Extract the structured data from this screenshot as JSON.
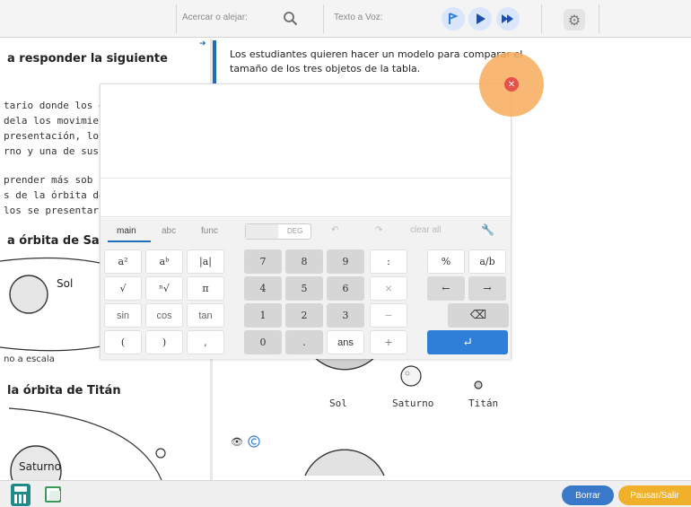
{
  "toolbar": {
    "zoom_label": "Acercar o alejar:",
    "tts_label": "Texto a Voz:"
  },
  "left": {
    "heading": "a responder la siguiente",
    "paragraph1": [
      "tario donde los e",
      "dela los movimie",
      "presentación, los",
      "rno y una de sus"
    ],
    "paragraph2": [
      "prender más sob",
      "s de la órbita de",
      "los se presentar"
    ],
    "orbit_sa_heading": "a órbita de Sa",
    "sol_label": "Sol",
    "scale_note": "no a escala",
    "orbit_titan_heading": "la órbita de Titán",
    "saturno_label": "Saturno"
  },
  "question": {
    "text": "Los estudiantes quieren hacer un modelo para comparar el tamaño de los tres objetos de la tabla."
  },
  "objects": {
    "sol": "Sol",
    "saturno": "Saturno",
    "titan": "Titán"
  },
  "calculator": {
    "tabs": [
      "main",
      "abc",
      "func"
    ],
    "active_tab": "main",
    "rad_deg": "DEG",
    "clear_all": "clear all",
    "keys": {
      "sq": "a²",
      "pow": "aᵇ",
      "abs": "|a|",
      "sqrt": "√",
      "nroot": "ⁿ√",
      "pi": "π",
      "sin": "sin",
      "cos": "cos",
      "tan": "tan",
      "lparen": "(",
      "rparen": ")",
      "comma": ",",
      "n7": "7",
      "n8": "8",
      "n9": "9",
      "n4": "4",
      "n5": "5",
      "n6": "6",
      "n1": "1",
      "n2": "2",
      "n3": "3",
      "n0": "0",
      "dot": ".",
      "ans": "ans",
      "colon": ":",
      "times": "×",
      "minus": "−",
      "plus": "+",
      "percent": "%",
      "frac": "a/b",
      "left": "←",
      "right": "→",
      "backspace": "⌫",
      "enter": "↵"
    }
  },
  "bottom": {
    "borrar": "Borrar",
    "pausar": "Pausar/Salir"
  },
  "colors": {
    "accent": "#1d6fb8",
    "enter_key": "#2f7fd9",
    "borrar": "#3a78c9",
    "pausar": "#f0b02a",
    "close": "#e8504b"
  }
}
